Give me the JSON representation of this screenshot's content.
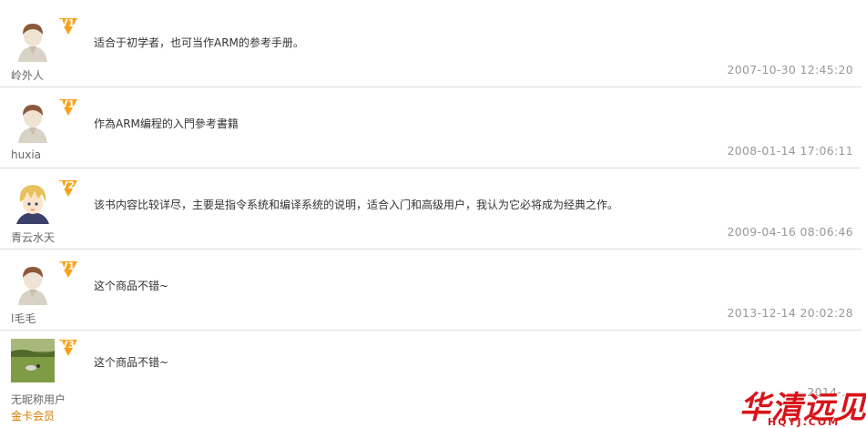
{
  "reviews": [
    {
      "user": "岭外人",
      "level": "V1",
      "level_color": "#f7a21a",
      "avatar": "default-avatar-icon",
      "text": "适合于初学者，也可当作ARM的参考手册。",
      "time": "2007-10-30 12:45:20"
    },
    {
      "user": "huxia",
      "level": "V1",
      "level_color": "#f7a21a",
      "avatar": "default-avatar-icon",
      "text": "作為ARM编程的入門參考書籍",
      "time": "2008-01-14 17:06:11"
    },
    {
      "user": "青云水天",
      "level": "V2",
      "level_color": "#f7a21a",
      "avatar": "anime-avatar",
      "text": "该书内容比较详尽，主要是指令系统和编译系统的说明，适合入门和高级用户，我认为它必将成为经典之作。",
      "time": "2009-04-16 08:06:46"
    },
    {
      "user": "l毛毛",
      "level": "V1",
      "level_color": "#f7a21a",
      "avatar": "default-avatar-icon",
      "text": "这个商品不错~",
      "time": "2013-12-14 20:02:28"
    },
    {
      "user": "无昵称用户",
      "member": "金卡会员",
      "level": "V3",
      "level_color": "#f7a21a",
      "avatar": "landscape-photo-avatar",
      "text": "这个商品不错~",
      "time": "2014-..."
    }
  ],
  "watermark": {
    "text": "华清远见",
    "subtext": "HQYJ.COM",
    "color": "#d7141a"
  }
}
